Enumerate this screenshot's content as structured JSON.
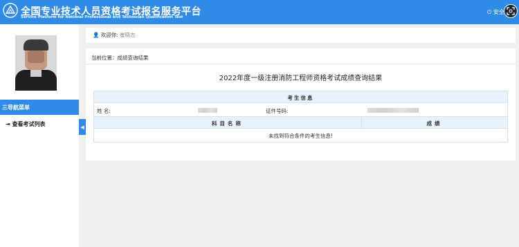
{
  "header": {
    "title": "全国专业技术人员资格考试报名服务平台",
    "subtitle": "Service Platform for National Professional and Technician Qualification Test",
    "logout_label": "安全",
    "logout_icon": "power-icon",
    "corner_icon": "expand-icon"
  },
  "sidebar": {
    "nav_title": "三导航菜单",
    "items": [
      {
        "label": "查看考试列表",
        "icon": "sign-in-icon"
      }
    ],
    "collapse_icon": "chevron-left-icon"
  },
  "welcome": {
    "prefix": "欢迎你:",
    "name": "崔晓志",
    "icon": "user-icon"
  },
  "breadcrumb": "当前位置：成绩查询结果",
  "result": {
    "title": "2022年度一级注册消防工程师资格考试成绩查询结果",
    "info_header": "考生信息",
    "name_label": "姓    名:",
    "id_label": "证件号码:",
    "subject_header": "科目名称",
    "score_header": "成绩",
    "empty_message": "未找到符合条件的考生信息!"
  },
  "colors": {
    "accent": "#2f8ae8",
    "table_header_bg": "#e8f2fc",
    "page_bg": "#f0f0f0"
  }
}
